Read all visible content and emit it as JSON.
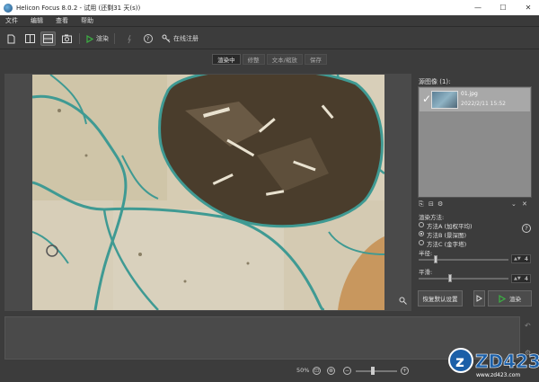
{
  "window": {
    "title": "Helicon Focus 8.0.2 - 试用 (还剩31 天(s))",
    "minimize": "—",
    "maximize": "☐",
    "close": "✕"
  },
  "menu": [
    "文件",
    "编辑",
    "查看",
    "帮助"
  ],
  "toolbar": {
    "render_label": "渲染",
    "register_label": "在线注册",
    "help_symbol": "?"
  },
  "tabs": [
    "渲染中",
    "修整",
    "文本/缩放",
    "保存"
  ],
  "source_panel": {
    "heading": "源图像 (1):",
    "item": {
      "name": "01.jpg",
      "date": "2022/2/11 15:52"
    }
  },
  "render_method": {
    "heading": "渲染方法:",
    "options": [
      "方法A (加权平均)",
      "方法B (景深图)",
      "方法C (金字塔)"
    ],
    "selected": 1
  },
  "params": {
    "radius_label": "半径:",
    "radius_value": "4",
    "smoothing_label": "平滑:",
    "smoothing_value": "4"
  },
  "buttons": {
    "reset": "恢复默认设置",
    "render": "渲染"
  },
  "status": {
    "zoom": "50%"
  },
  "watermark": {
    "brand": "ZD423",
    "url": "www.zd423.com"
  },
  "colors": {
    "accent_green": "#3cb043",
    "selected_item": "#a8a8a8"
  }
}
